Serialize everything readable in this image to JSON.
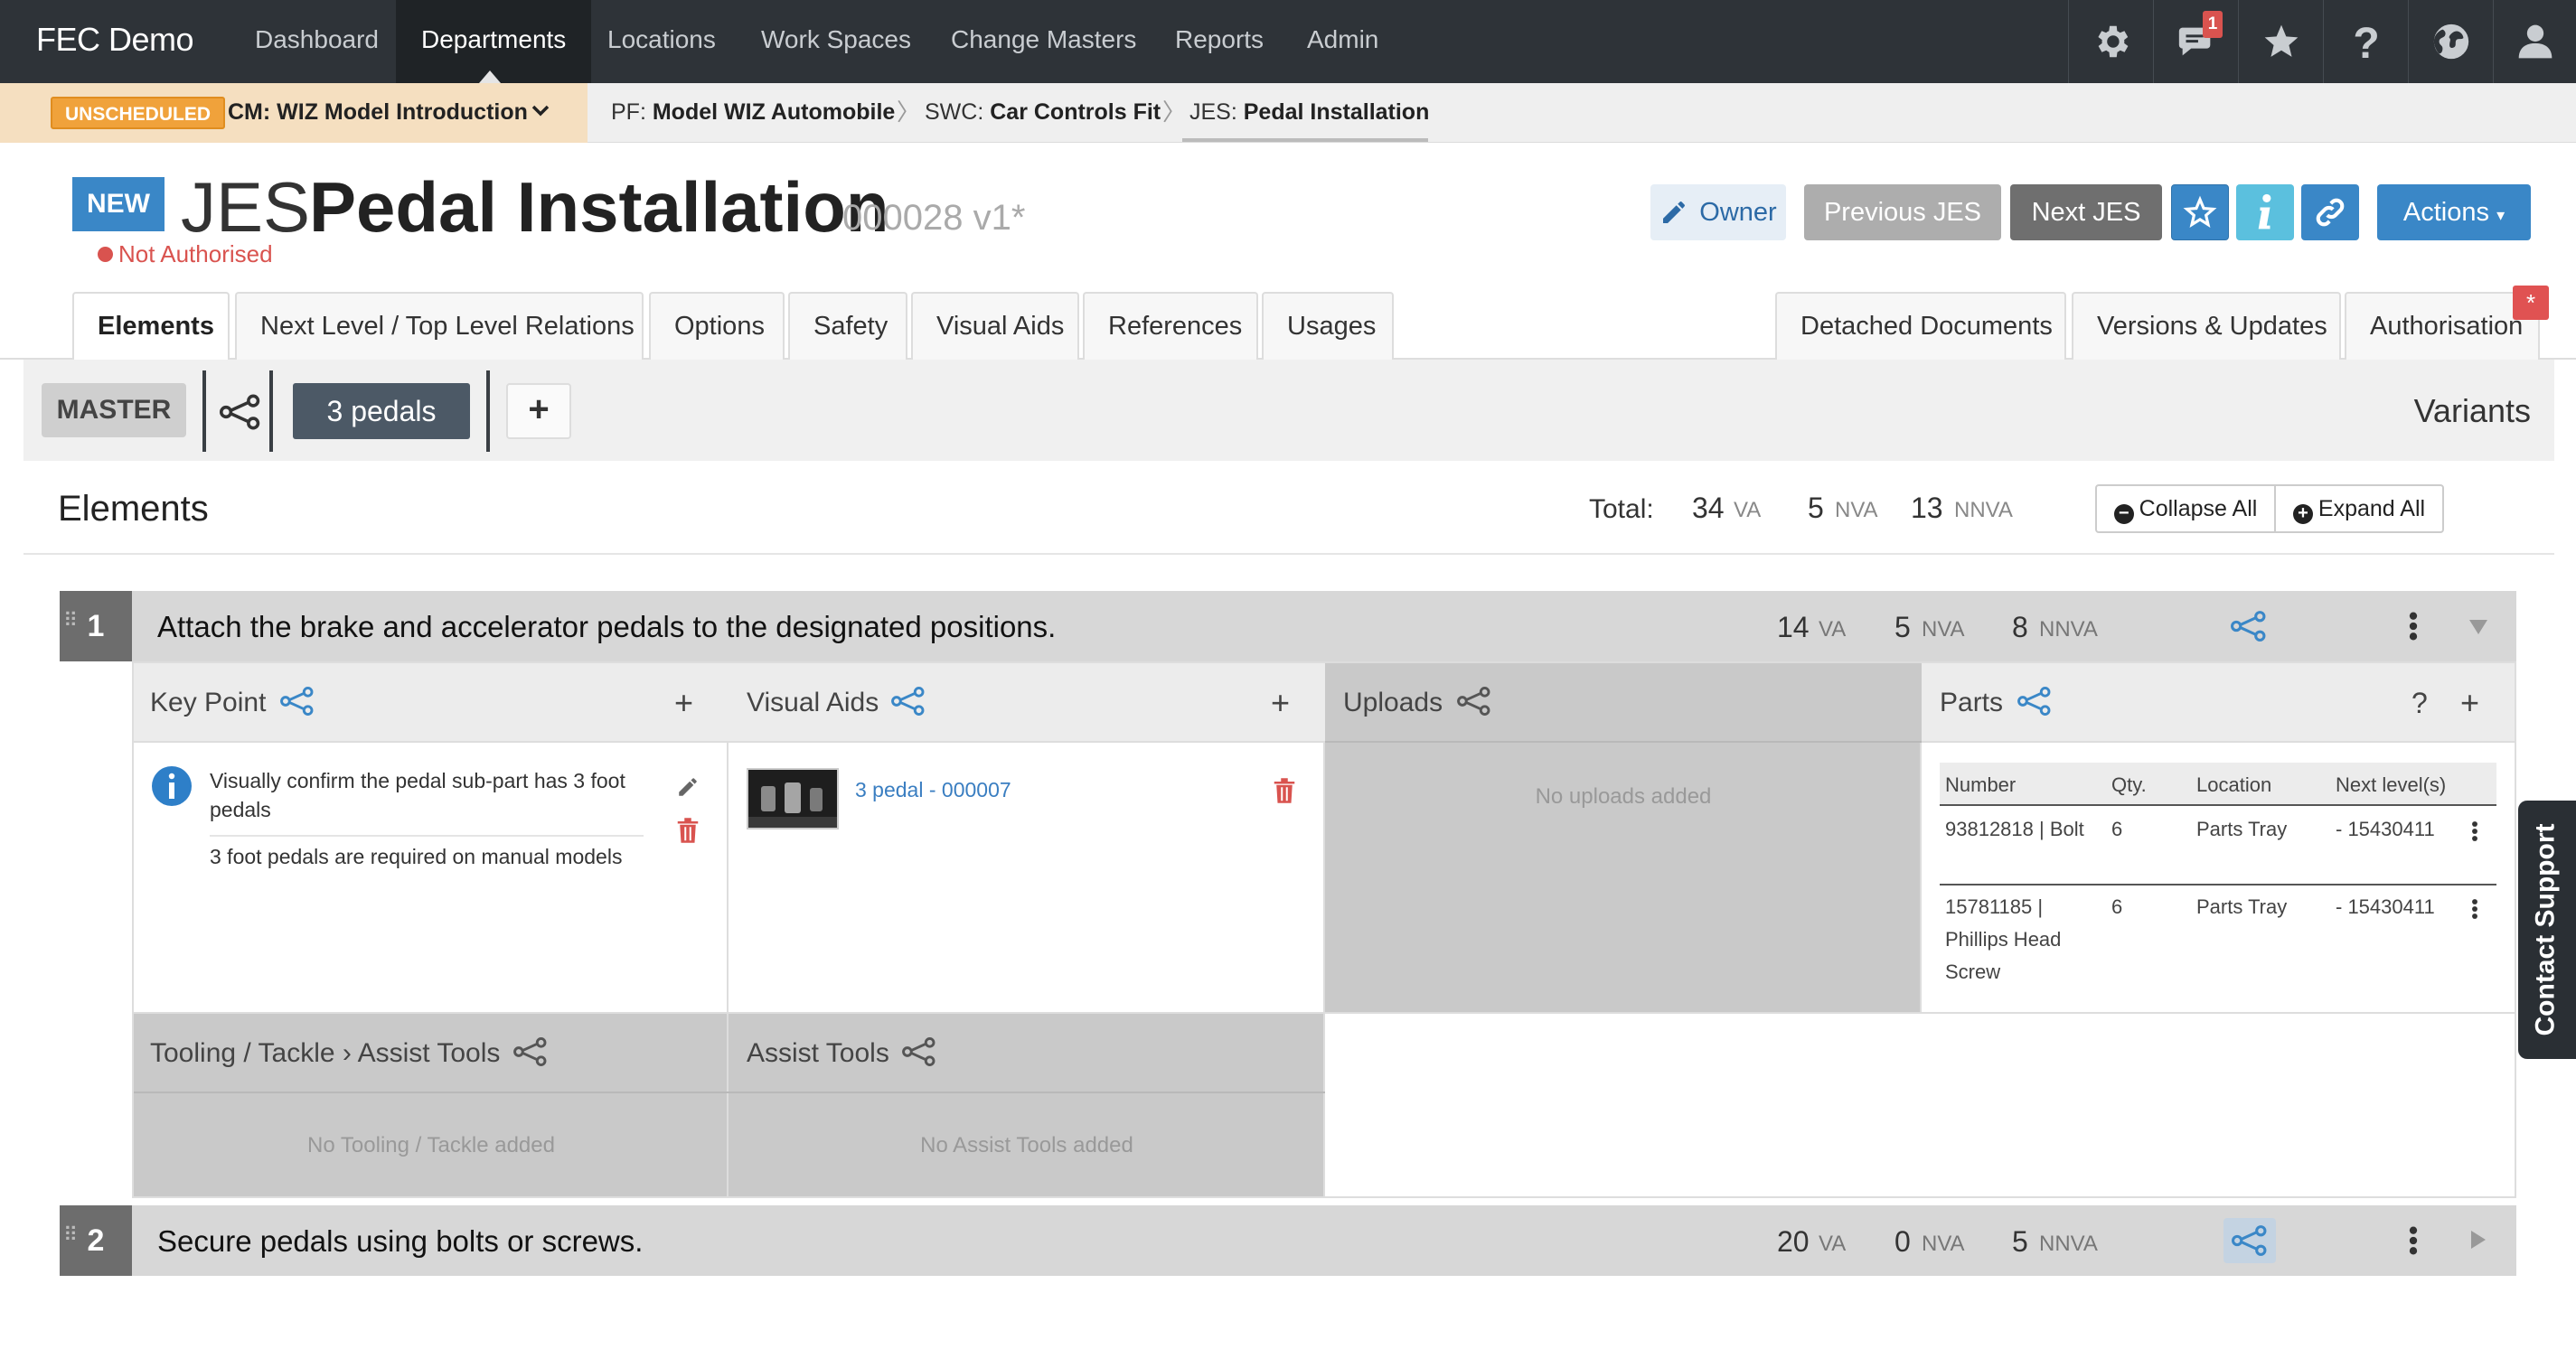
{
  "app": {
    "brand": "FEC Demo"
  },
  "nav": {
    "items": [
      "Dashboard",
      "Departments",
      "Locations",
      "Work Spaces",
      "Change Masters",
      "Reports",
      "Admin"
    ],
    "active": "Departments",
    "icons": [
      "gear-icon",
      "notifications-icon",
      "star-icon",
      "help-icon",
      "globe-icon",
      "user-icon"
    ],
    "notification_count": "1"
  },
  "breadcrumb": {
    "status": "UNSCHEDULED",
    "cm_prefix": "CM:",
    "cm_value": "WIZ Model Introduction",
    "pf_prefix": "PF:",
    "pf_value": "Model WIZ Automobile",
    "swc_prefix": "SWC:",
    "swc_value": "Car Controls Fit",
    "jes_prefix": "JES:",
    "jes_value": "Pedal Installation"
  },
  "header": {
    "badge": "NEW",
    "prefix": "JES",
    "title": "Pedal Installation",
    "version": "000028 v1*",
    "status": "Not Authorised",
    "buttons": {
      "owner": "Owner",
      "previous": "Previous JES",
      "next": "Next JES",
      "actions": "Actions"
    }
  },
  "tabs": {
    "left": [
      "Elements",
      "Next Level / Top Level Relations",
      "Options",
      "Safety",
      "Visual Aids",
      "References",
      "Usages"
    ],
    "right": [
      "Detached Documents",
      "Versions & Updates",
      "Authorisation"
    ],
    "active": "Elements",
    "auth_flag": "*"
  },
  "variants": {
    "master": "MASTER",
    "selected": "3 pedals",
    "add": "+",
    "label": "Variants"
  },
  "elements": {
    "title": "Elements",
    "total_label": "Total:",
    "total_va": "34",
    "total_nva": "5",
    "total_nnva": "13",
    "units": {
      "va": "VA",
      "nva": "NVA",
      "nnva": "NNVA"
    },
    "collapse_all": "Collapse All",
    "expand_all": "Expand All",
    "rows": [
      {
        "num": "1",
        "description": "Attach the brake and accelerator pedals to the designated positions.",
        "va": "14",
        "nva": "5",
        "nnva": "8",
        "panels": {
          "key_point": {
            "title": "Key Point",
            "text": "Visually confirm the pedal sub-part has 3 foot pedals",
            "reason": "3 foot pedals are required on manual models"
          },
          "visual_aids": {
            "title": "Visual Aids",
            "item": "3 pedal - 000007"
          },
          "uploads": {
            "title": "Uploads",
            "empty": "No uploads added"
          },
          "parts": {
            "title": "Parts",
            "help": "?",
            "columns": [
              "Number",
              "Qty.",
              "Location",
              "Next level(s)"
            ],
            "rows": [
              {
                "number": "93812818 | Bolt",
                "qty": "6",
                "location": "Parts Tray",
                "next": "- 15430411"
              },
              {
                "number_lines": [
                  "15781185 |",
                  "Phillips Head",
                  "Screw"
                ],
                "qty": "6",
                "location": "Parts Tray",
                "next": "- 15430411"
              }
            ]
          },
          "tooling": {
            "title": "Tooling / Tackle › Assist Tools",
            "empty": "No Tooling / Tackle added"
          },
          "assist_tools": {
            "title": "Assist Tools",
            "empty": "No Assist Tools added"
          }
        }
      },
      {
        "num": "2",
        "description": "Secure pedals using bolts or screws.",
        "va": "20",
        "nva": "0",
        "nnva": "5"
      }
    ]
  },
  "support": {
    "label": "Contact Support"
  },
  "colors": {
    "primary": "#3a87c7",
    "danger": "#d9534f",
    "nav": "#2e3338",
    "warning": "#f0a23b",
    "info": "#5bc0de"
  }
}
